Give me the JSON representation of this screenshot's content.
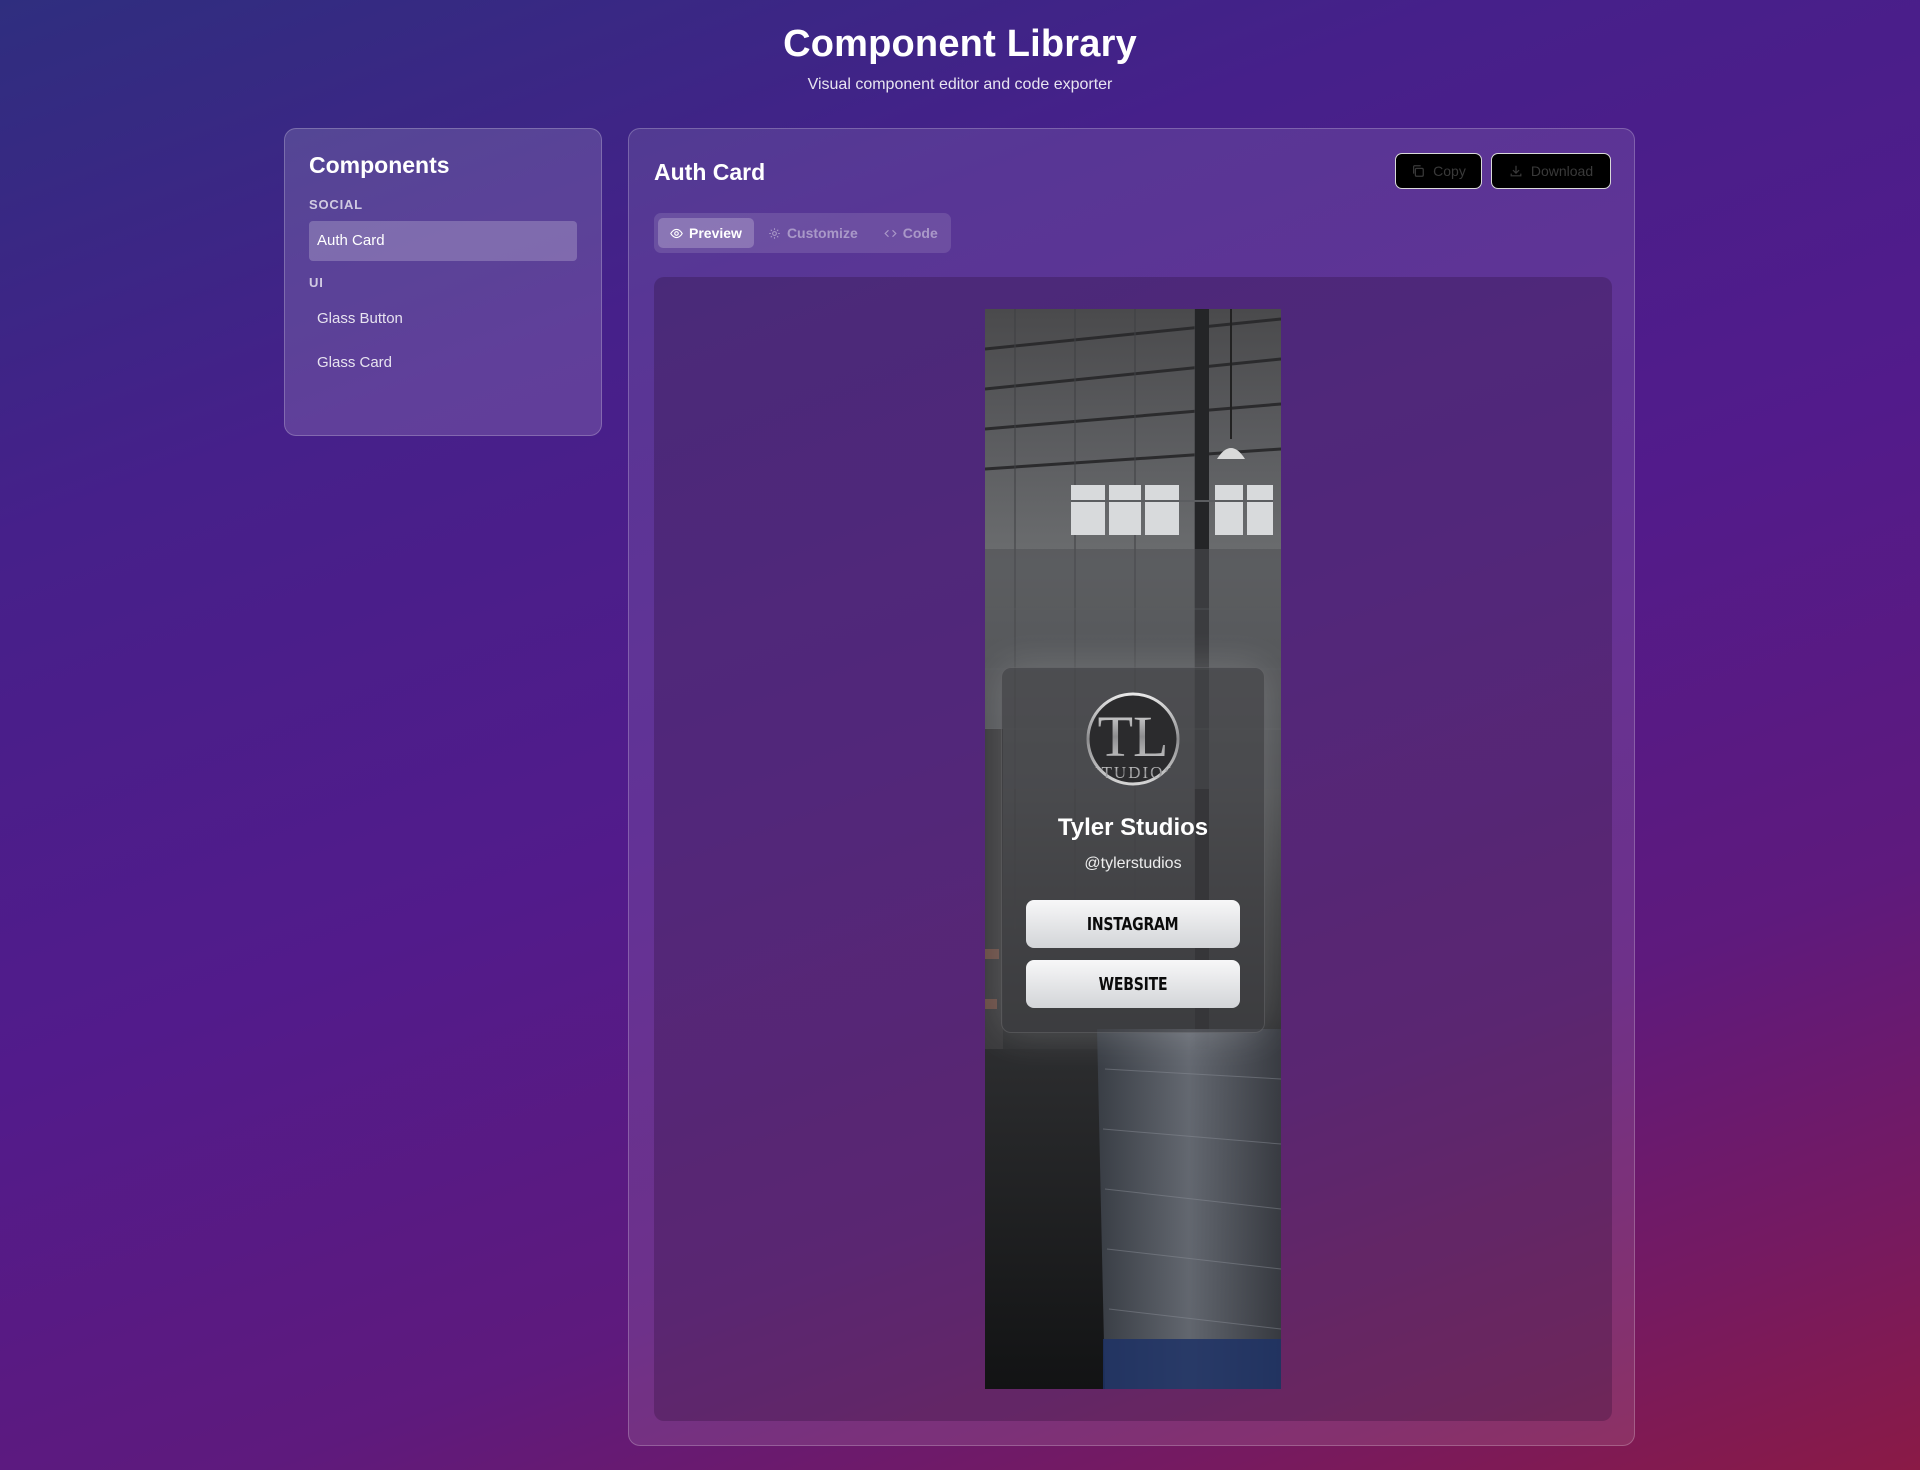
{
  "header": {
    "title": "Component Library",
    "subtitle": "Visual component editor and code exporter"
  },
  "sidebar": {
    "title": "Components",
    "groups": [
      {
        "label": "SOCIAL",
        "items": [
          {
            "label": "Auth Card",
            "active": true
          }
        ]
      },
      {
        "label": "UI",
        "items": [
          {
            "label": "Glass Button"
          },
          {
            "label": "Glass Card"
          }
        ]
      }
    ]
  },
  "main": {
    "title": "Auth Card",
    "actions": {
      "copy_label": "Copy",
      "download_label": "Download"
    },
    "tabs": [
      {
        "label": "Preview",
        "icon": "eye-icon",
        "active": true
      },
      {
        "label": "Customize",
        "icon": "gear-icon"
      },
      {
        "label": "Code",
        "icon": "code-icon"
      }
    ]
  },
  "preview": {
    "profile": {
      "logo_text_top": "TL",
      "logo_text_bottom": "STUDIOS",
      "name": "Tyler Studios",
      "handle": "@tylerstudios"
    },
    "links": [
      {
        "label": "INSTAGRAM"
      },
      {
        "label": "WEBSITE"
      }
    ]
  },
  "colors": {
    "accent_active": "#ffffff",
    "action_button_bg": "#000000"
  }
}
